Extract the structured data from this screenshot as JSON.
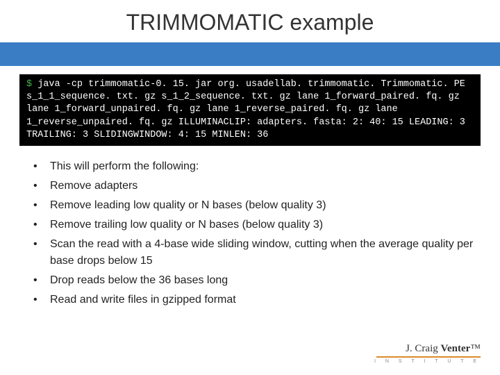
{
  "title": "TRIMMOMATIC example",
  "code": {
    "prompt": "$",
    "command": " java -cp trimmomatic-0. 15. jar org. usadellab. trimmomatic. Trimmomatic. PE s_1_1_sequence. txt. gz s_1_2_sequence. txt. gz lane 1_forward_paired. fq. gz lane 1_forward_unpaired. fq. gz lane 1_reverse_paired. fq. gz lane 1_reverse_unpaired. fq. gz ILLUMINACLIP: adapters. fasta: 2: 40: 15 LEADING: 3 TRAILING: 3 SLIDINGWINDOW: 4: 15 MINLEN: 36"
  },
  "bullets": [
    "This will perform the following:",
    "Remove adapters",
    "Remove leading low quality or N bases (below quality 3)",
    "Remove trailing low quality or N bases (below quality 3)",
    "Scan the read with a 4-base wide sliding window, cutting when the average quality per base drops below 15",
    "Drop reads below the 36 bases long",
    "Read and write files in gzipped format"
  ],
  "footer": {
    "name": "J. Craig Venter",
    "sub": "I N S T I T U T E"
  }
}
